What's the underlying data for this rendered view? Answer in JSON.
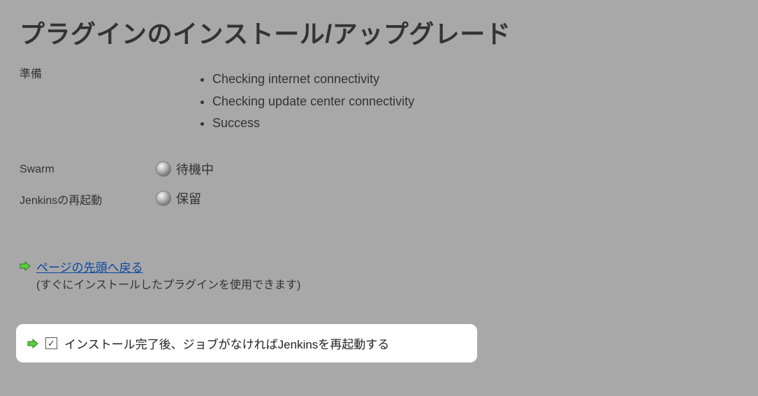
{
  "page": {
    "title": "プラグインのインストール/アップグレード",
    "prepare_label": "準備",
    "checks": {
      "c0": "Checking internet connectivity",
      "c1": "Checking update center connectivity",
      "c2": "Success"
    },
    "rows": {
      "swarm_label": "Swarm",
      "swarm_status": "待機中",
      "restart_label": "Jenkinsの再起動",
      "restart_status": "保留"
    },
    "actions": {
      "back_link": "ページの先頭へ戻る",
      "back_note": "(すぐにインストールしたプラグインを使用できます)",
      "restart_checkbox_label": "インストール完了後、ジョブがなければJenkinsを再起動する"
    }
  }
}
